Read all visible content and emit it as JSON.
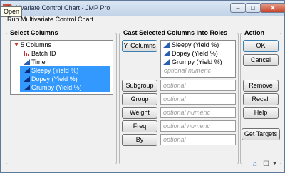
{
  "window": {
    "title": "Multivariate Control Chart - JMP Pro",
    "tooltip": "Open",
    "subtitle": "Run Multivariate Control Chart",
    "minimize_glyph": "–",
    "maximize_glyph": "□",
    "close_glyph": "✕"
  },
  "select_columns": {
    "label": "Select Columns",
    "header": "5 Columns",
    "columns": [
      {
        "name": "Batch ID",
        "type": "nominal",
        "selected": false
      },
      {
        "name": "Time",
        "type": "continuous",
        "selected": false
      },
      {
        "name": "Sleepy (Yield %)",
        "type": "continuous",
        "selected": true
      },
      {
        "name": "Dopey (Yield %)",
        "type": "continuous",
        "selected": true
      },
      {
        "name": "Grumpy (Yield %)",
        "type": "continuous",
        "selected": true
      }
    ]
  },
  "roles": {
    "label": "Cast Selected Columns into Roles",
    "y_columns": {
      "button": "Y, Columns",
      "items": [
        "Sleepy (Yield %)",
        "Dopey (Yield %)",
        "Grumpy (Yield %)"
      ],
      "placeholder": "optional numeric"
    },
    "subgroup": {
      "button": "Subgroup",
      "placeholder": "optional"
    },
    "group": {
      "button": "Group",
      "placeholder": "optional"
    },
    "weight": {
      "button": "Weight",
      "placeholder": "optional numeric"
    },
    "freq": {
      "button": "Freq",
      "placeholder": "optional numeric"
    },
    "by": {
      "button": "By",
      "placeholder": "optional"
    }
  },
  "action": {
    "label": "Action",
    "ok": "OK",
    "cancel": "Cancel",
    "remove": "Remove",
    "recall": "Recall",
    "help": "Help",
    "get_targets": "Get Targets"
  },
  "colors": {
    "selection": "#3399ff",
    "continuous_icon": "#2a5fb0",
    "nominal_icon": "#c03030"
  }
}
